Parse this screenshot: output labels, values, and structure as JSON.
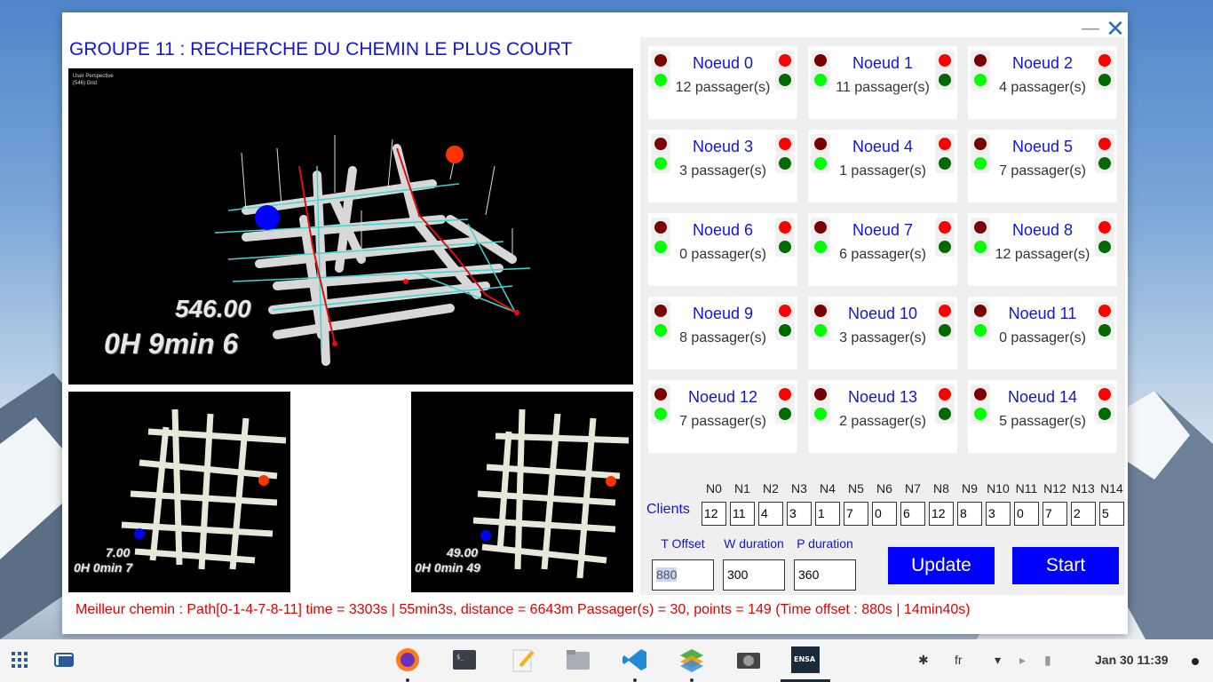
{
  "window": {
    "title": "GROUPE 11 : RECHERCHE DU CHEMIN LE PLUS COURT",
    "minimize_icon": "minimize-icon",
    "close_icon": "close-icon"
  },
  "views": {
    "main": {
      "perspective_line1": "User Perspective",
      "perspective_line2": "(546) Grid",
      "value": "546.00",
      "time": "0H 9min 6"
    },
    "left": {
      "value": "7.00",
      "time": "0H 0min 7"
    },
    "right": {
      "value": "49.00",
      "time": "0H 0min 49"
    }
  },
  "nodes": [
    {
      "name": "Noeud 0",
      "passengers": "12 passager(s)"
    },
    {
      "name": "Noeud 1",
      "passengers": "11 passager(s)"
    },
    {
      "name": "Noeud 2",
      "passengers": "4 passager(s)"
    },
    {
      "name": "Noeud 3",
      "passengers": "3 passager(s)"
    },
    {
      "name": "Noeud 4",
      "passengers": "1 passager(s)"
    },
    {
      "name": "Noeud 5",
      "passengers": "7 passager(s)"
    },
    {
      "name": "Noeud 6",
      "passengers": "0 passager(s)"
    },
    {
      "name": "Noeud 7",
      "passengers": "6 passager(s)"
    },
    {
      "name": "Noeud 8",
      "passengers": "12 passager(s)"
    },
    {
      "name": "Noeud 9",
      "passengers": "8 passager(s)"
    },
    {
      "name": "Noeud 10",
      "passengers": "3 passager(s)"
    },
    {
      "name": "Noeud 11",
      "passengers": "0 passager(s)"
    },
    {
      "name": "Noeud 12",
      "passengers": "7 passager(s)"
    },
    {
      "name": "Noeud 13",
      "passengers": "2 passager(s)"
    },
    {
      "name": "Noeud 14",
      "passengers": "5 passager(s)"
    }
  ],
  "node_colors": {
    "dark_red": "#7a0000",
    "red": "#ff0000",
    "lime": "#00ff00",
    "green": "#006a00"
  },
  "clients": {
    "label": "Clients",
    "headers": [
      "N0",
      "N1",
      "N2",
      "N3",
      "N4",
      "N5",
      "N6",
      "N7",
      "N8",
      "N9",
      "N10",
      "N11",
      "N12",
      "N13",
      "N14"
    ],
    "values": [
      "12",
      "11",
      "4",
      "3",
      "1",
      "7",
      "0",
      "6",
      "12",
      "8",
      "3",
      "0",
      "7",
      "2",
      "5"
    ]
  },
  "fields": {
    "t_offset": {
      "label": "T Offset",
      "value": "880"
    },
    "w_duration": {
      "label": "W duration",
      "value": "300"
    },
    "p_duration": {
      "label": "P duration",
      "value": "360"
    }
  },
  "buttons": {
    "update": "Update",
    "start": "Start"
  },
  "result": "Meilleur chemin : Path[0-1-4-7-8-11] time = 3303s | 55min3s, distance = 6643m Passager(s) = 30, points = 149 (Time offset : 880s | 14min40s)",
  "taskbar": {
    "apps": [
      "apps-grid-icon",
      "workspaces-icon",
      "firefox-icon",
      "terminal-icon",
      "text-editor-icon",
      "files-icon",
      "vscode-icon",
      "layers-icon",
      "camera-icon",
      "ensa-app-icon"
    ],
    "tray": {
      "bluetooth_icon": "bluetooth-icon",
      "language": "fr",
      "wifi_icon": "wifi-icon",
      "volume_icon": "volume-icon",
      "battery_icon": "battery-icon",
      "datetime": "Jan 30  11:39"
    }
  }
}
